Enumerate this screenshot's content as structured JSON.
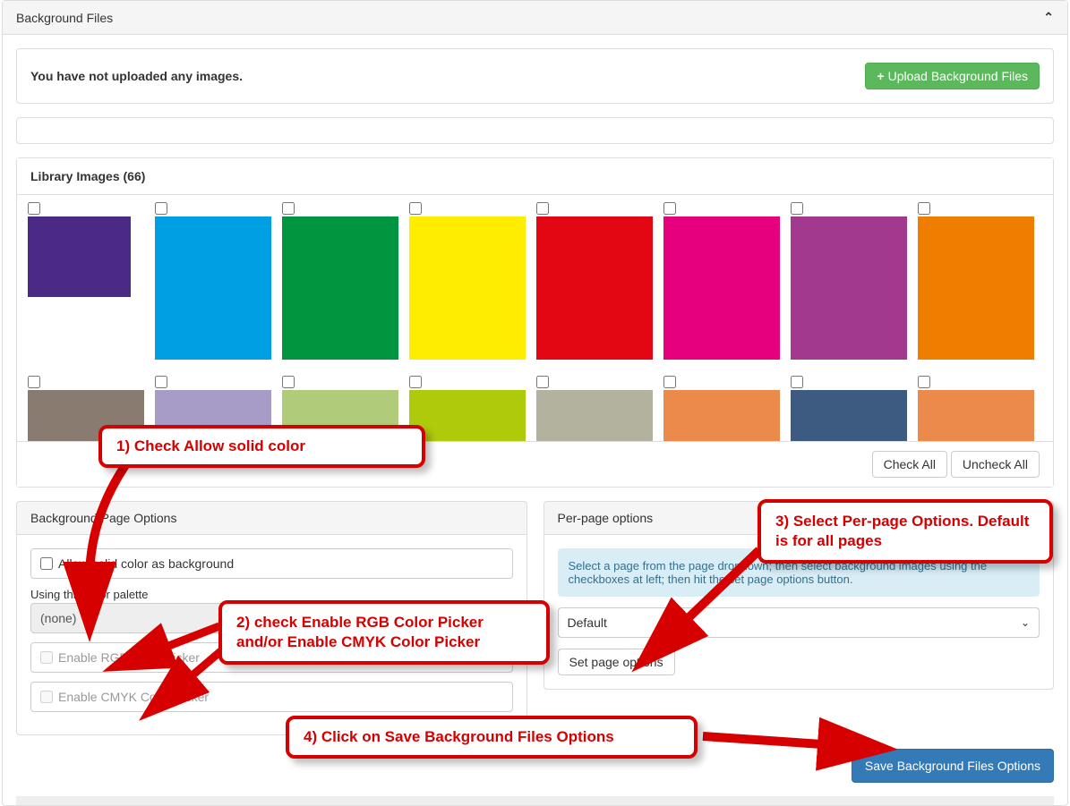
{
  "header": {
    "title": "Background Files"
  },
  "upload": {
    "empty_text": "You have not uploaded any images.",
    "button_label": "Upload Background Files"
  },
  "library": {
    "title": "Library Images (66)",
    "check_all": "Check All",
    "uncheck_all": "Uncheck All",
    "row1_colors": [
      "#4a2a85",
      "#009fe3",
      "#009640",
      "#ffed00",
      "#e30613",
      "#e6007e",
      "#a3388f",
      "#ef7d00"
    ],
    "row2_colors": [
      "#8a7b70",
      "#a79cc8",
      "#b0cb7a",
      "#afca0b",
      "#b2b29e",
      "#ec8a4b",
      "#3d5a80",
      "#ec8a4b"
    ]
  },
  "bg_options": {
    "title": "Background Page Options",
    "allow_solid": "Allow solid color as background",
    "palette_label": "Using this color palette",
    "palette_value": "(none)",
    "rgb": "Enable RGB Color Picker",
    "cmyk": "Enable CMYK Color Picker"
  },
  "per_page": {
    "title": "Per-page options",
    "info": "Select a page from the page dropdown; then select background images using the checkboxes at left; then hit the set page options button.",
    "selected": "Default",
    "set_button": "Set page options"
  },
  "save_button": "Save Background Files Options",
  "annotations": {
    "step1": "1) Check Allow solid color",
    "step2": "2) check Enable RGB Color Picker and/or Enable CMYK Color Picker",
    "step3": "3) Select Per-page Options. Default is for all pages",
    "step4": "4) Click on Save Background Files Options"
  }
}
